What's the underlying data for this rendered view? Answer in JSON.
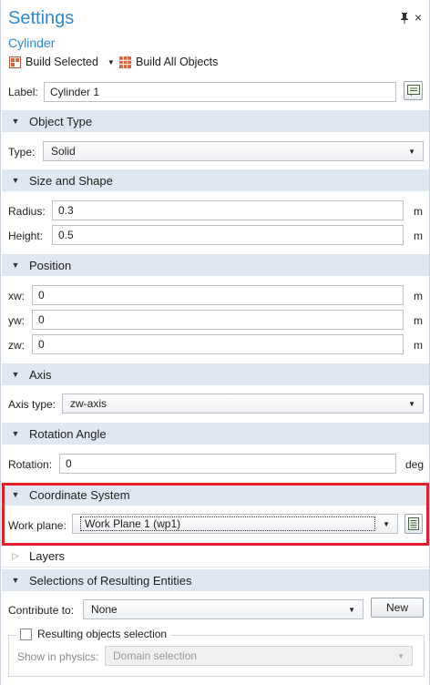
{
  "header": {
    "title": "Settings",
    "subtitle": "Cylinder",
    "build_selected_label": "Build Selected",
    "build_all_label": "Build All Objects"
  },
  "label_row": {
    "label": "Label:",
    "value": "Cylinder 1"
  },
  "object_type": {
    "header": "Object Type",
    "type_label": "Type:",
    "type_value": "Solid"
  },
  "size_shape": {
    "header": "Size and Shape",
    "radius_label": "Radius:",
    "radius_value": "0.3",
    "radius_unit": "m",
    "height_label": "Height:",
    "height_value": "0.5",
    "height_unit": "m"
  },
  "position": {
    "header": "Position",
    "xw_label": "xw:",
    "xw_value": "0",
    "xw_unit": "m",
    "yw_label": "yw:",
    "yw_value": "0",
    "yw_unit": "m",
    "zw_label": "zw:",
    "zw_value": "0",
    "zw_unit": "m"
  },
  "axis": {
    "header": "Axis",
    "axis_type_label": "Axis type:",
    "axis_type_value": "zw-axis"
  },
  "rotation": {
    "header": "Rotation Angle",
    "rotation_label": "Rotation:",
    "rotation_value": "0",
    "rotation_unit": "deg"
  },
  "coordinate_system": {
    "header": "Coordinate System",
    "work_plane_label": "Work plane:",
    "work_plane_value": "Work Plane 1 (wp1)"
  },
  "layers": {
    "header": "Layers"
  },
  "selections": {
    "header": "Selections of Resulting Entities",
    "contribute_label": "Contribute to:",
    "contribute_value": "None",
    "new_button": "New",
    "resulting_selection_label": "Resulting objects selection",
    "resulting_selection_checked": false,
    "show_in_physics_label": "Show in physics:",
    "show_in_physics_value": "Domain selection"
  },
  "colors": {
    "accent": "#2a8ad2",
    "section_bg": "#dfe8f2",
    "highlight": "#e3202a"
  }
}
